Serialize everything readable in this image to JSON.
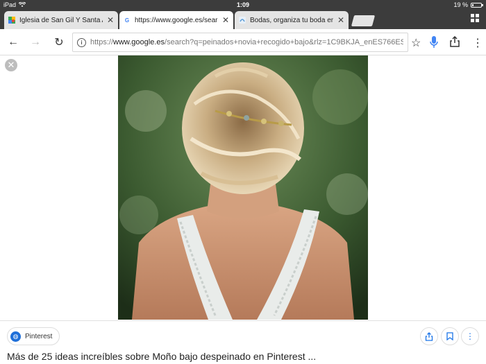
{
  "status": {
    "device": "iPad",
    "time": "1:09",
    "battery": "19 %",
    "battery_level": 0.19
  },
  "tabs": [
    {
      "title": "Iglesia de San Gil Y Santa An",
      "icon": "maps-icon",
      "active": false
    },
    {
      "title": "https://www.google.es/sear",
      "icon": "google-icon",
      "active": true
    },
    {
      "title": "Bodas, organiza tu boda en",
      "icon": "bodas-icon",
      "active": false
    }
  ],
  "toolbar": {
    "url_prefix": "https://",
    "url_host": "www.google.es",
    "url_rest": "/search?q=peinados+novia+recogido+bajo&rlz=1C9BKJA_enES766ES..."
  },
  "result": {
    "source": "Pinterest",
    "caption": "Más de 25 ideas increíbles sobre Moño bajo despeinado en Pinterest ..."
  },
  "colors": {
    "chrome_dark": "#3c3c3c",
    "accent": "#1a73e8"
  }
}
